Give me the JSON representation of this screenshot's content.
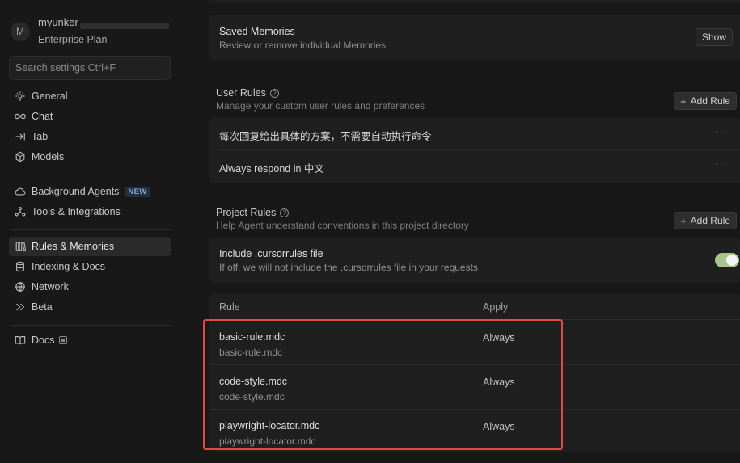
{
  "user": {
    "initial": "M",
    "name": "myunker",
    "plan": "Enterprise Plan"
  },
  "search": {
    "placeholder": "Search settings Ctrl+F"
  },
  "nav": {
    "general": "General",
    "chat": "Chat",
    "tab": "Tab",
    "models": "Models",
    "background_agents": "Background Agents",
    "background_badge": "NEW",
    "tools": "Tools & Integrations",
    "rules": "Rules & Memories",
    "indexing": "Indexing & Docs",
    "network": "Network",
    "beta": "Beta",
    "docs": "Docs"
  },
  "saved_memories": {
    "title": "Saved Memories",
    "subtitle": "Review or remove individual Memories",
    "button": "Show"
  },
  "user_rules": {
    "title": "User Rules",
    "subtitle": "Manage your custom user rules and preferences",
    "add_button": "Add Rule",
    "rules": [
      "每次回复给出具体的方案，不需要自动执行命令",
      "Always respond in 中文"
    ],
    "more": "···"
  },
  "project_rules": {
    "title": "Project Rules",
    "subtitle": "Help Agent understand conventions in this project directory",
    "add_button": "Add Rule",
    "cursorrules": {
      "title": "Include .cursorrules file",
      "subtitle": "If off, we will not include the .cursorrules file in your requests",
      "enabled": true
    },
    "table": {
      "col_rule": "Rule",
      "col_apply": "Apply",
      "rows": [
        {
          "name": "basic-rule.mdc",
          "path": "basic-rule.mdc",
          "apply": "Always"
        },
        {
          "name": "code-style.mdc",
          "path": "code-style.mdc",
          "apply": "Always"
        },
        {
          "name": "playwright-locator.mdc",
          "path": "playwright-locator.mdc",
          "apply": "Always"
        }
      ]
    }
  },
  "colors": {
    "accent_toggle": "#a8c58a",
    "highlight": "#e04b3f",
    "background": "#181818"
  }
}
